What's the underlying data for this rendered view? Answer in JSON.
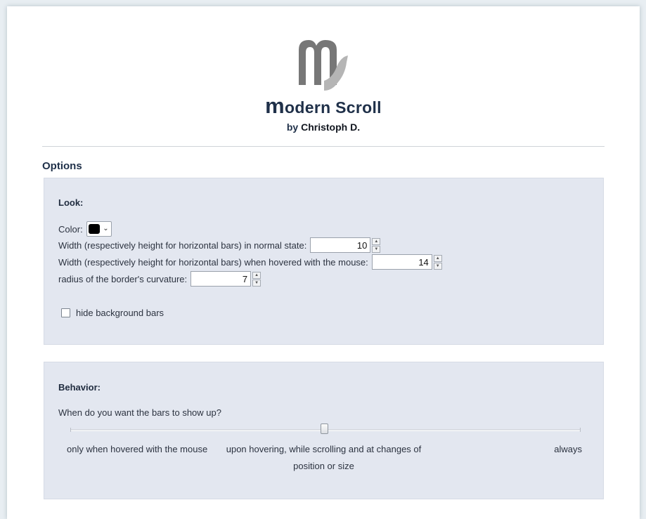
{
  "header": {
    "title_initial": "m",
    "title_rest": "odern Scroll",
    "byline_prefix": "by",
    "author": "Christoph D."
  },
  "options": {
    "heading": "Options",
    "look": {
      "title": "Look:",
      "color_label": "Color:",
      "color_value": "#000000",
      "normal_width_label": "Width (respectively height for horizontal bars) in normal state:",
      "normal_width_value": "10",
      "hover_width_label": "Width (respectively height for horizontal bars) when hovered with the mouse:",
      "hover_width_value": "14",
      "radius_label": "radius of the border's curvature:",
      "radius_value": "7",
      "hide_background_label": "hide background bars",
      "hide_background_checked": false
    },
    "behavior": {
      "title": "Behavior:",
      "question": "When do you want the bars to show up?",
      "slider_options": [
        "only when hovered with the mouse",
        "upon hovering, while scrolling and at changes of position or size",
        "always"
      ],
      "slider_selected_index": 1
    }
  }
}
